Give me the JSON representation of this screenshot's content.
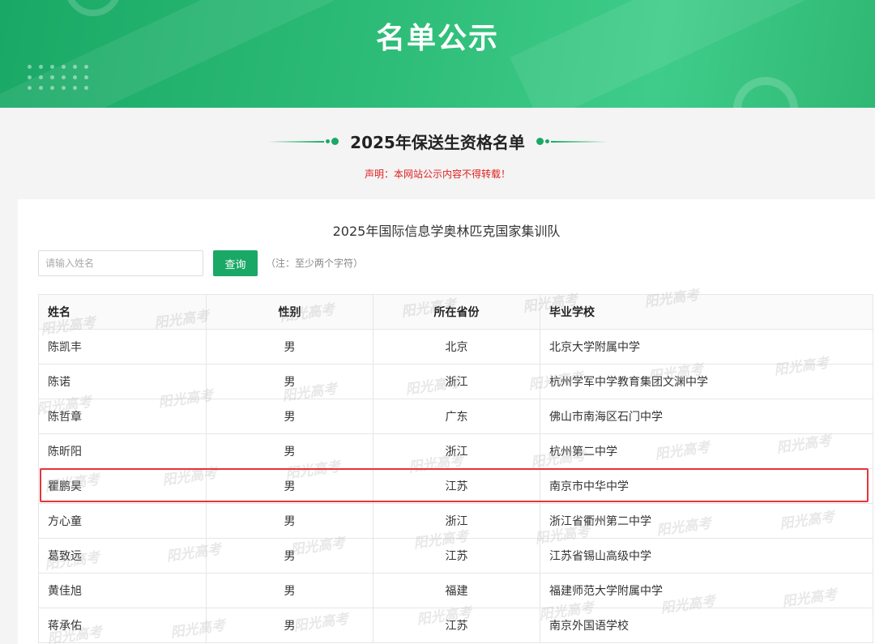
{
  "banner": {
    "title": "名单公示"
  },
  "section": {
    "title": "2025年保送生资格名单",
    "notice": "声明：本网站公示内容不得转载！"
  },
  "panel": {
    "title": "2025年国际信息学奥林匹克国家集训队"
  },
  "search": {
    "placeholder": "请输入姓名",
    "button_label": "查询",
    "note": "（注：至少两个字符）"
  },
  "table": {
    "headers": {
      "name": "姓名",
      "gender": "性别",
      "province": "所在省份",
      "school": "毕业学校"
    },
    "rows": [
      {
        "name": "陈凯丰",
        "gender": "男",
        "province": "北京",
        "school": "北京大学附属中学"
      },
      {
        "name": "陈诺",
        "gender": "男",
        "province": "浙江",
        "school": "杭州学军中学教育集团文渊中学"
      },
      {
        "name": "陈哲章",
        "gender": "男",
        "province": "广东",
        "school": "佛山市南海区石门中学"
      },
      {
        "name": "陈昕阳",
        "gender": "男",
        "province": "浙江",
        "school": "杭州第二中学"
      },
      {
        "name": "瞿鹏昊",
        "gender": "男",
        "province": "江苏",
        "school": "南京市中华中学"
      },
      {
        "name": "方心童",
        "gender": "男",
        "province": "浙江",
        "school": "浙江省衢州第二中学"
      },
      {
        "name": "葛致远",
        "gender": "男",
        "province": "江苏",
        "school": "江苏省锡山高级中学"
      },
      {
        "name": "黄佳旭",
        "gender": "男",
        "province": "福建",
        "school": "福建师范大学附属中学"
      },
      {
        "name": "蒋承佑",
        "gender": "男",
        "province": "江苏",
        "school": "南京外国语学校"
      }
    ]
  },
  "watermark": {
    "text": "阳光高考"
  },
  "colors": {
    "accent": "#1aa866",
    "notice": "#e02020",
    "highlight": "#e8333a"
  }
}
